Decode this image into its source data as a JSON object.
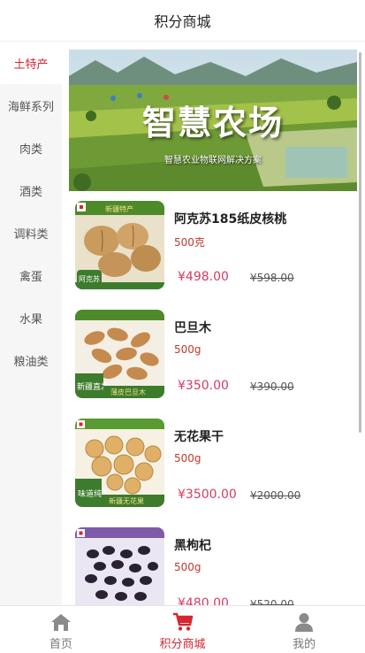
{
  "page": {
    "title": "积分商城"
  },
  "sidebar": {
    "items": [
      {
        "label": "土特产",
        "active": true
      },
      {
        "label": "海鲜系列"
      },
      {
        "label": "肉类"
      },
      {
        "label": "酒类"
      },
      {
        "label": "调料类"
      },
      {
        "label": "禽蛋"
      },
      {
        "label": "水果"
      },
      {
        "label": "粮油类"
      }
    ]
  },
  "banner": {
    "title": "智慧农场",
    "subtitle": "智慧农业物联网解决方案"
  },
  "products": [
    {
      "name": "阿克苏185纸皮核桃",
      "spec": "500克",
      "price": "¥498.00",
      "original_price": "¥598.00",
      "image_badge": "阿克苏",
      "image_tag": "新疆特产"
    },
    {
      "name": "巴旦木",
      "spec": "500g",
      "price": "¥350.00",
      "original_price": "¥390.00",
      "image_badge": "新疆直发",
      "image_tag": "薄皮巴旦木"
    },
    {
      "name": "无花果干",
      "spec": "500g",
      "price": "¥3500.00",
      "original_price": "¥2000.00",
      "image_badge": "味道纯正",
      "image_tag": "新疆无花果"
    },
    {
      "name": "黑枸杞",
      "spec": "500g",
      "price": "¥480.00",
      "original_price": "¥520.00",
      "image_badge": "",
      "image_tag": ""
    }
  ],
  "tabbar": {
    "tabs": [
      {
        "label": "首页",
        "icon": "home-icon"
      },
      {
        "label": "积分商城",
        "icon": "cart-icon",
        "active": true
      },
      {
        "label": "我的",
        "icon": "user-icon"
      }
    ]
  },
  "colors": {
    "accent": "#d6262f",
    "price": "#d63a63",
    "spec": "#c0392b",
    "sidebar_bg": "#f6f6f6"
  }
}
